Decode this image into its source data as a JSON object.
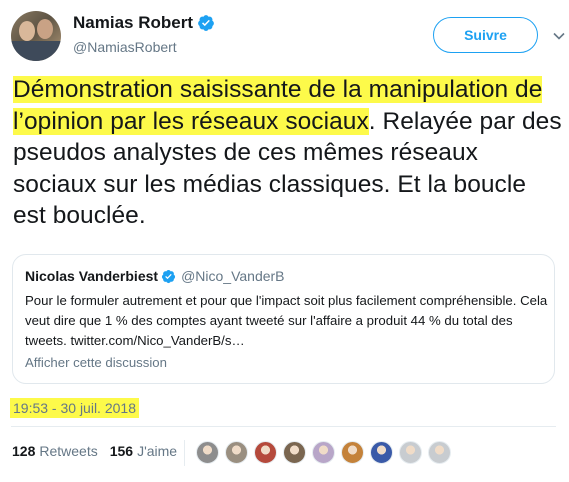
{
  "author": {
    "display_name": "Namias Robert",
    "handle": "@NamiasRobert",
    "verified": true,
    "avatar_icon": "profile-photo"
  },
  "actions": {
    "follow_label": "Suivre",
    "more_icon": "chevron-down-icon"
  },
  "tweet": {
    "highlighted_text": "Démonstration saisissante de la manipulation de l’opinion par les réseaux sociaux",
    "remaining_text": ". Relayée par des pseudos analystes de ces mêmes réseaux sociaux sur les médias classiques. Et la boucle est bouclée.",
    "highlight_color": "#fdfa4a"
  },
  "quoted_tweet": {
    "display_name": "Nicolas Vanderbiest",
    "handle": "@Nico_VanderB",
    "verified": true,
    "text": "Pour le formuler autrement et pour que l'impact soit plus facilement compréhensible. Cela veut dire que 1 % des comptes ayant tweeté sur l'affaire a produit 44 % du total des tweets. twitter.com/Nico_VanderB/s…",
    "show_thread_label": "Afficher cette discussion"
  },
  "timestamp": "19:53 - 30 juil. 2018",
  "stats": {
    "retweets_count": "128",
    "retweets_label": "Retweets",
    "likes_count": "156",
    "likes_label": "J'aime"
  },
  "likers": [
    {
      "name": "liker-avatar-1",
      "color": "#8d8d8d"
    },
    {
      "name": "liker-avatar-2",
      "color": "#9a8f80"
    },
    {
      "name": "liker-avatar-3",
      "color": "#b54a3c"
    },
    {
      "name": "liker-avatar-4",
      "color": "#7a6650"
    },
    {
      "name": "liker-avatar-5",
      "color": "#b8a6c8"
    },
    {
      "name": "liker-avatar-6",
      "color": "#c4823a"
    },
    {
      "name": "liker-avatar-7",
      "color": "#3a5aa8"
    },
    {
      "name": "liker-avatar-8",
      "color": "#c8ccd0"
    },
    {
      "name": "liker-avatar-9",
      "color": "#c8ccd0"
    }
  ],
  "colors": {
    "accent": "#1da1f2",
    "secondary_text": "#657786",
    "border": "#e1e8ed"
  }
}
